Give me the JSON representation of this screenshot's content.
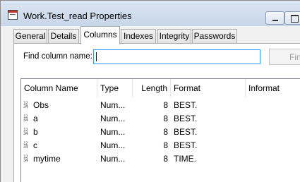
{
  "window": {
    "title": "Work.Test_read Properties"
  },
  "tabs": [
    {
      "label": "General"
    },
    {
      "label": "Details"
    },
    {
      "label": "Columns"
    },
    {
      "label": "Indexes"
    },
    {
      "label": "Integrity"
    },
    {
      "label": "Passwords"
    }
  ],
  "active_tab": "Columns",
  "find": {
    "label": "Find column name:",
    "value": "",
    "button_label": "Find"
  },
  "columns_table": {
    "headers": [
      "Column Name",
      "Type",
      "Length",
      "Format",
      "Informat"
    ],
    "rows": [
      {
        "icon": "numeric-column-icon",
        "name": "Obs",
        "type": "Num...",
        "length": "8",
        "format": "BEST."
      },
      {
        "icon": "numeric-column-icon",
        "name": "a",
        "type": "Num...",
        "length": "8",
        "format": "BEST."
      },
      {
        "icon": "numeric-column-icon",
        "name": "b",
        "type": "Num...",
        "length": "8",
        "format": "BEST."
      },
      {
        "icon": "numeric-column-icon",
        "name": "c",
        "type": "Num...",
        "length": "8",
        "format": "BEST."
      },
      {
        "icon": "numeric-column-icon",
        "name": "mytime",
        "type": "Num...",
        "length": "8",
        "format": "TIME."
      }
    ]
  }
}
